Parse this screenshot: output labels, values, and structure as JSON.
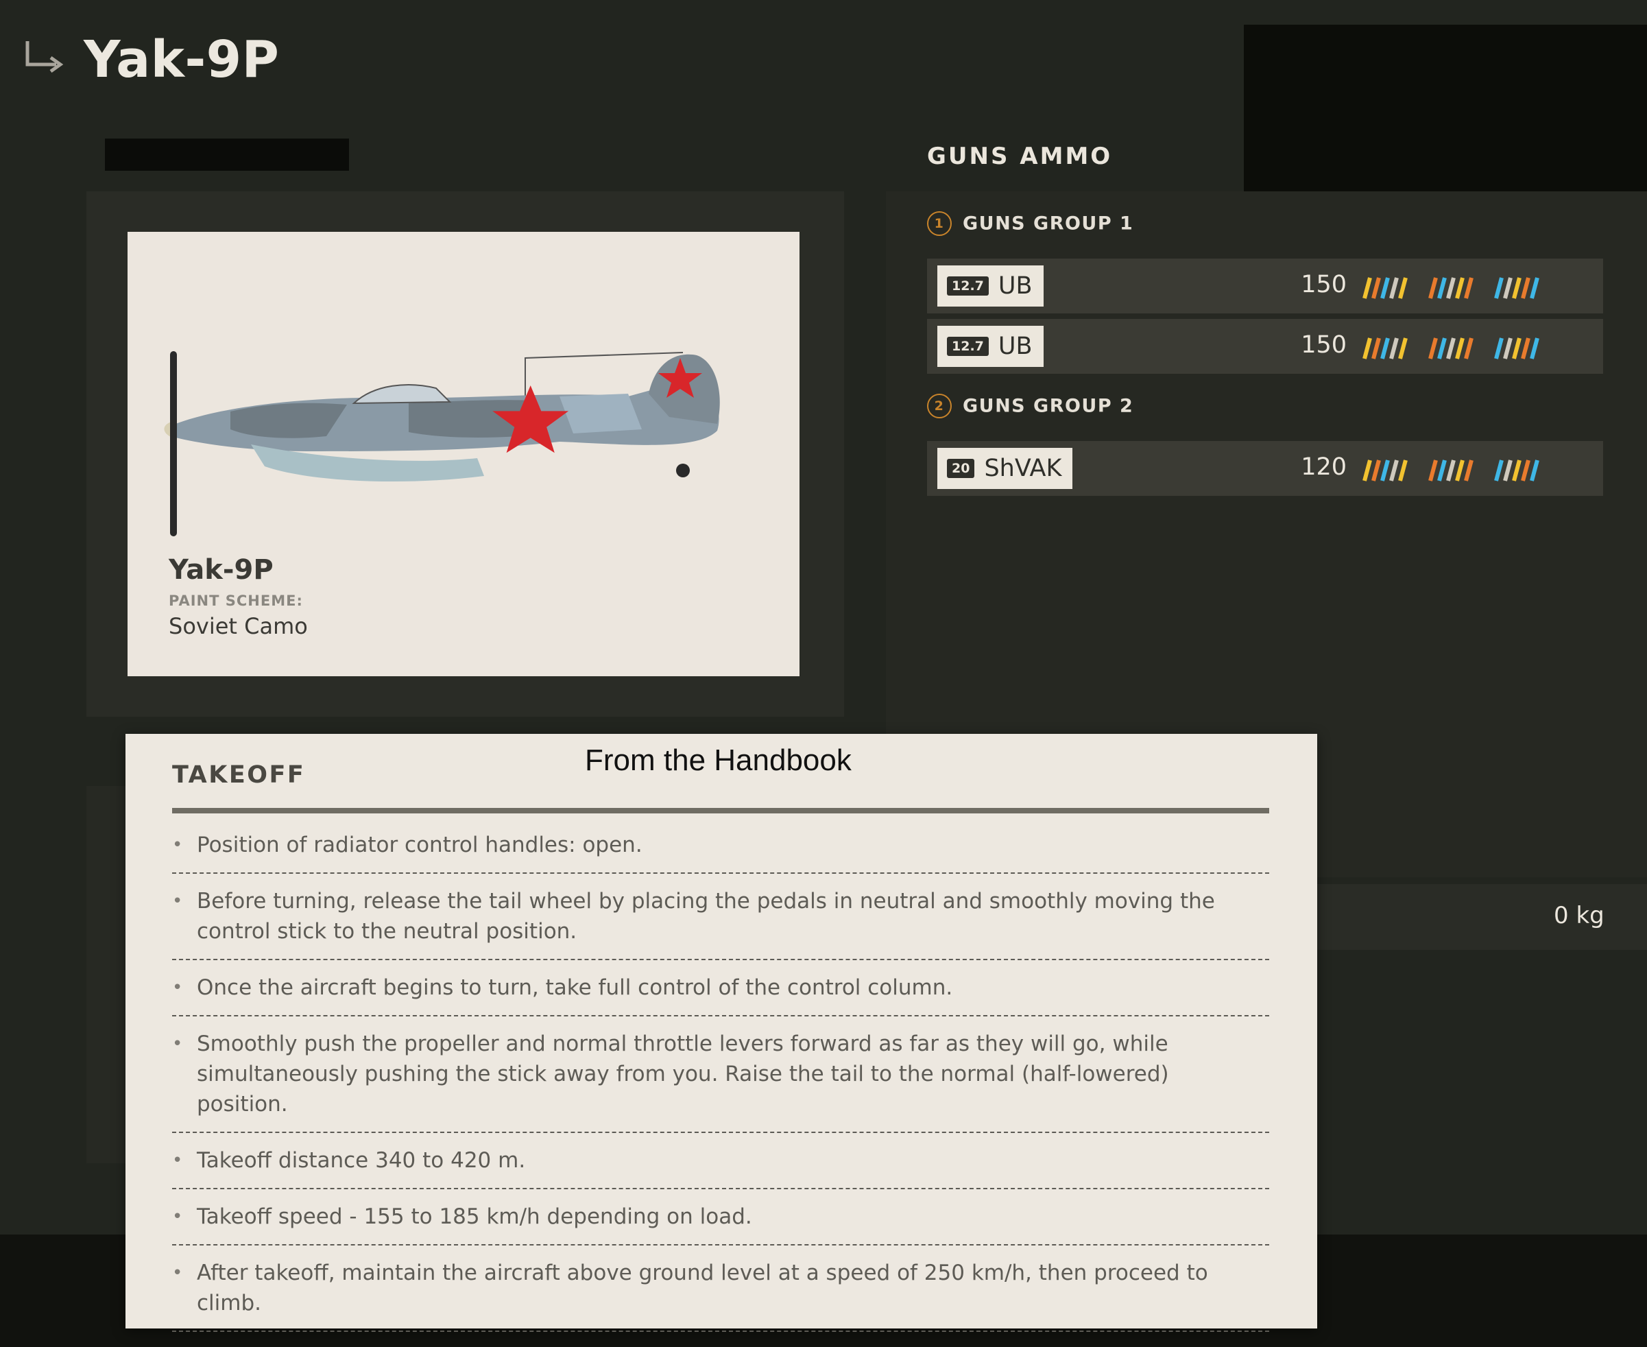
{
  "header": {
    "title": "Yak-9P",
    "back_icon": "return-arrow-icon"
  },
  "aircraft_card": {
    "name": "Yak-9P",
    "paint_scheme_label": "PAINT SCHEME:",
    "paint_scheme_value": "Soviet Camo"
  },
  "ammo": {
    "title": "GUNS AMMO",
    "groups": [
      {
        "number": "1",
        "label": "GUNS GROUP 1",
        "guns": [
          {
            "caliber": "12.7",
            "name": "UB",
            "count": "150"
          },
          {
            "caliber": "12.7",
            "name": "UB",
            "count": "150"
          }
        ]
      },
      {
        "number": "2",
        "label": "GUNS GROUP 2",
        "guns": [
          {
            "caliber": "20",
            "name": "ShVAK",
            "count": "120"
          }
        ]
      }
    ]
  },
  "payload": {
    "weight": "0 kg"
  },
  "handbook": {
    "title": "From the Handbook",
    "section": "TAKEOFF",
    "items": [
      "Position of radiator control handles: open.",
      "Before turning, release the tail wheel by placing the pedals in neutral and smoothly moving the control stick to the neutral position.",
      "Once the aircraft begins to turn, take full control of the control column.",
      "Smoothly push the propeller and normal throttle levers forward as far as they will go, while simultaneously pushing the stick away from you. Raise the tail to the normal (half-lowered) position.",
      "Takeoff distance 340 to 420 m.",
      "Takeoff speed - 155 to 185 km/h depending on load.",
      "After takeoff, maintain the aircraft above ground level at a speed of 250 km/h, then proceed to climb."
    ]
  },
  "colors": {
    "background": "#22251f",
    "panel": "#2a2c26",
    "card": "#ece6de",
    "accent_orange": "#c9842b",
    "belt_colors": [
      "#f2c230",
      "#e97b2d",
      "#3fb7e6",
      "#cfc9bd"
    ]
  }
}
